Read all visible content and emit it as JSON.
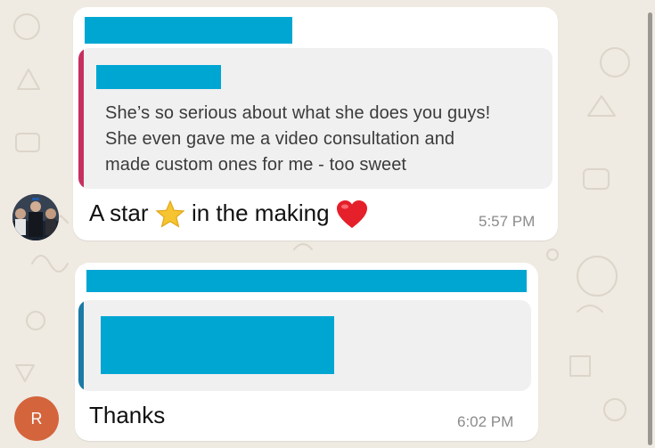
{
  "messages": [
    {
      "quote_lines": [
        "She’s so serious about what she does you guys!",
        "She even gave me a video consultation and",
        "made custom ones for me - too sweet"
      ],
      "text_before": "A star",
      "text_after": "in the making",
      "time": "5:57 PM",
      "quote_accent": "#c6305f"
    },
    {
      "text": "Thanks",
      "time": "6:02 PM",
      "avatar_initial": "R",
      "avatar_color": "#d4643c",
      "quote_accent": "#1b7aa6"
    }
  ],
  "redaction_color": "#00a6d2",
  "icons": [
    "star-emoji",
    "red-heart-emoji",
    "user-photo-avatar"
  ]
}
